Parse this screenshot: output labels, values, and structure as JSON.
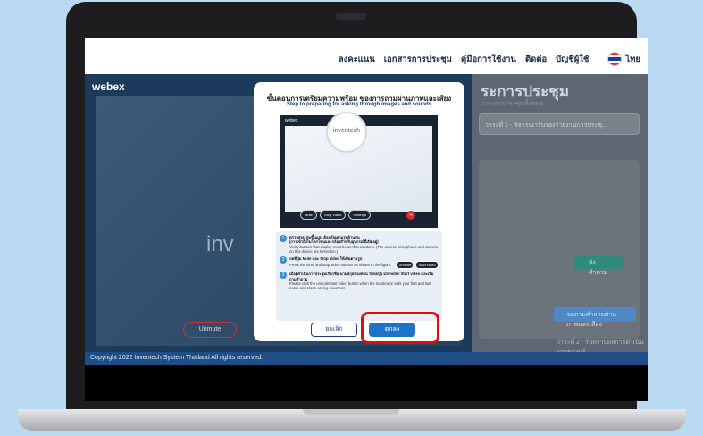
{
  "nav": {
    "items": [
      "ลงคะแนน",
      "เอกสารการประชุม",
      "คู่มือการใช้งาน",
      "ติดต่อ",
      "บัญชีผู้ใช้"
    ],
    "lang": "ไทย"
  },
  "left": {
    "webex": "webex",
    "inv_text": "inv",
    "unmute": "Unmute"
  },
  "right": {
    "title": "ระการประชุม",
    "subtitle": "วาระการประชุมทั้งหมด",
    "agenda_box": "วาระที่ 1 - พิจารณารับรองรายงานการประชุ...",
    "btn1": "ส่งคำถาม",
    "btn2": "ขอถามคำถามผ่านภาพและเสียง",
    "bottom": "วาระที่ 2 - รับทราบผลการดำเนินงานของบริ..."
  },
  "footer": {
    "text": "Copyright 2022 Inventech System Thailand All rights reserved."
  },
  "modal": {
    "title": "ขั้นตอนการเตรียมความพร้อม ของการถามผ่านภาพและเสียง",
    "subtitle": "Step to preparing for asking through images and sounds",
    "preview_webex": "webex",
    "preview_logo": "inventech",
    "preview_buttons": [
      "Mute",
      "Stop Video",
      "Settings"
    ],
    "steps": [
      {
        "num": "1",
        "bold": "ตรวจสอบ ปุ่มขึ้นแสง ต้องเป็นตามรูปด้านบน",
        "sub": "(การเข้าถึงไมโครโฟนและกล้องสำหรับอุปกรณ์นี้เปิดอยู่)",
        "text": "Verify buttons that display must be as that as above (The access microphone and camera on this device are turned on.)"
      },
      {
        "num": "2",
        "bold": "กดที่ปุ่ม Mute และ Stop video ให้เป็นตามรูป",
        "text": "Press the must and stop video buttons as shown in the figure."
      },
      {
        "num": "3",
        "bold": "เมื่อผู้ดำเนินการประชุมเรียกชื่อ-นามสกุลของท่าน ให้กดปุ่ม Unmute / Start video และเริ่มถามคำถาม",
        "text": "Please click the unmute/start video button when the moderator calls your first and last name and starts asking questions."
      }
    ],
    "mini_buttons": [
      "Unmute",
      "Start video"
    ],
    "cancel": "ยกเลิก",
    "ok": "ตกลง"
  }
}
